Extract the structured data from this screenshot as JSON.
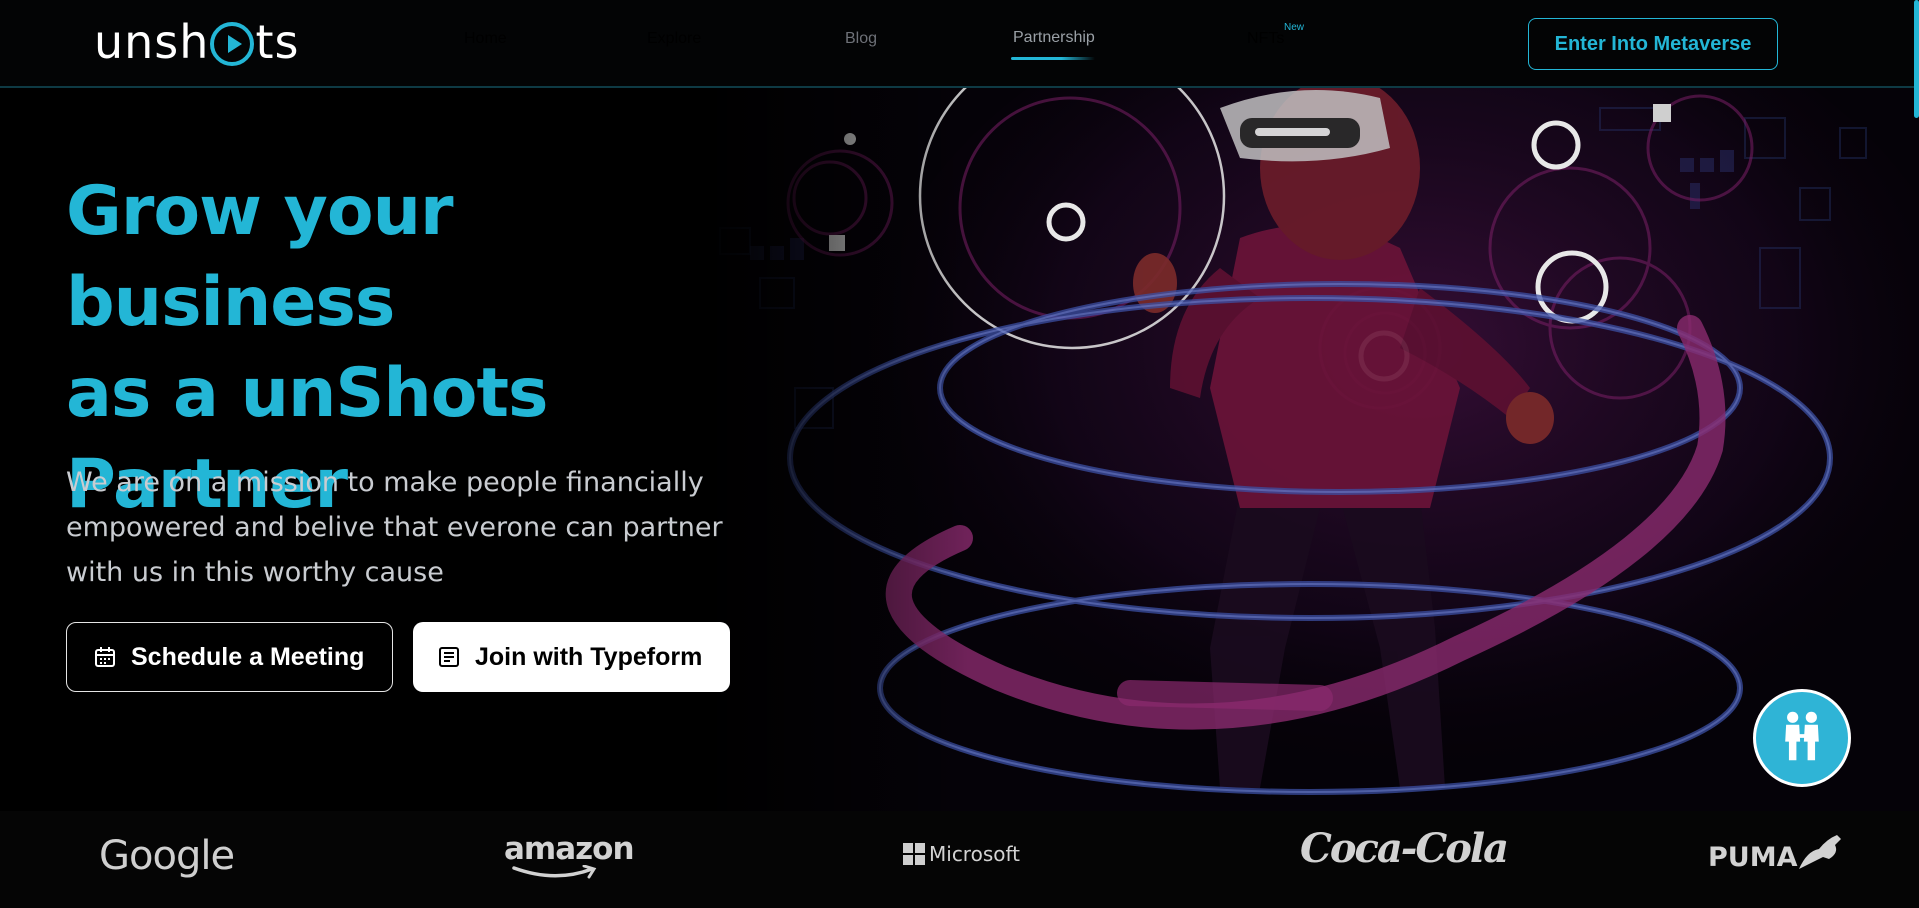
{
  "header": {
    "logo": {
      "before": "unsh",
      "after": "ts"
    },
    "nav": [
      {
        "label": "Home",
        "state": "default"
      },
      {
        "label": "Explore",
        "state": "default"
      },
      {
        "label": "Blog",
        "state": "muted"
      },
      {
        "label": "Partnership",
        "state": "active"
      },
      {
        "label": "NFTs",
        "state": "default"
      }
    ],
    "nft_badge": "New",
    "cta_label": "Enter Into Metaverse"
  },
  "hero": {
    "title_lines": [
      "Grow your business",
      "as a unShots",
      "Partner"
    ],
    "subtitle_lines": [
      "We are on a mission to make people financially",
      "empowered and belive that everone can partner",
      "with us in this worthy cause"
    ],
    "buttons": {
      "schedule": "Schedule a Meeting",
      "typeform": "Join with Typeform"
    }
  },
  "brands": {
    "google": "Google",
    "amazon": "amazon",
    "microsoft": "Microsoft",
    "cocacola": "Coca-Cola",
    "puma": "PUMA"
  },
  "theme": {
    "accent": "#23b6d6",
    "background": "#000000",
    "text_light": "#c9ccd1"
  },
  "icons": [
    "calendar-icon",
    "form-icon",
    "handshake-icon",
    "play-logo-icon"
  ]
}
